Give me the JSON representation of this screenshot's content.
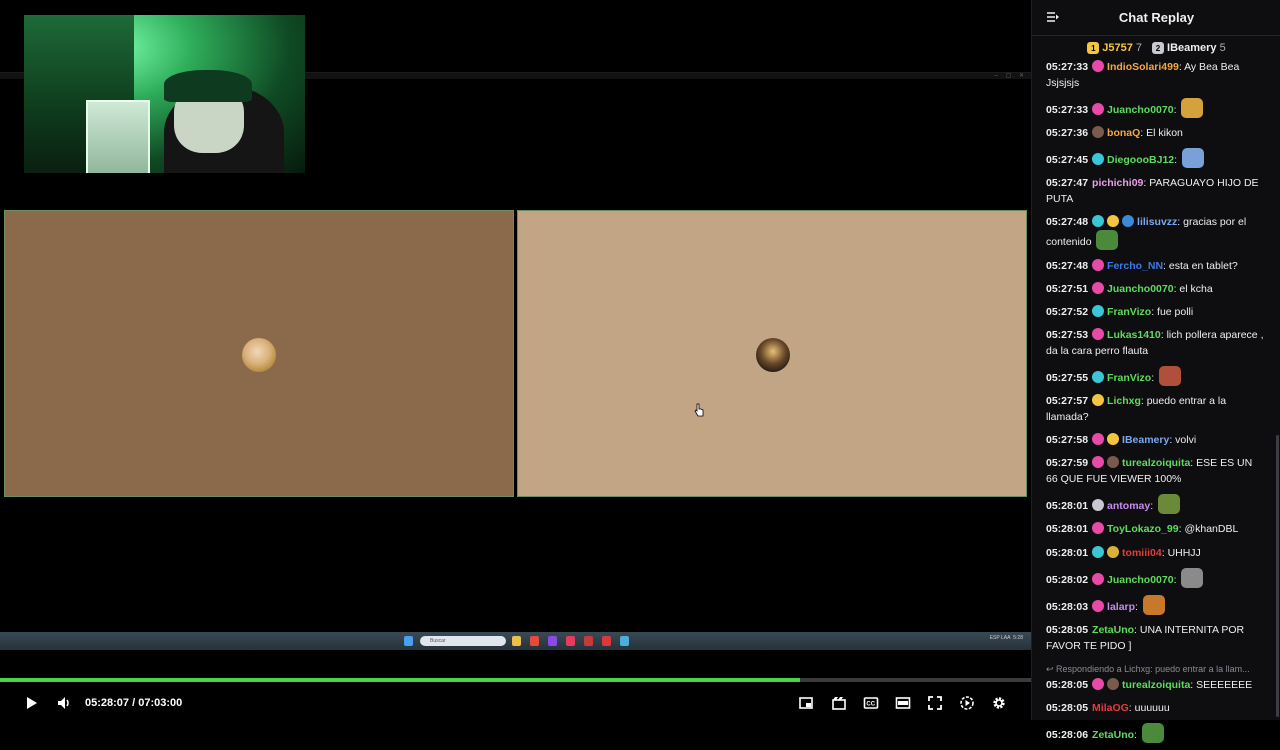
{
  "player": {
    "current_time": "05:28:07",
    "separator": "/",
    "duration": "07:03:00",
    "progress": 0.776
  },
  "desktop": {
    "search_placeholder": "Buscar",
    "tray_lang": "ESP LAA",
    "tray_time": "5:28"
  },
  "chat": {
    "title": "Chat Replay",
    "leaderboard": [
      {
        "rank": "1",
        "name": "J5757",
        "count": "7",
        "name_color": "#f5c542",
        "rank_bg": "#f5c542"
      },
      {
        "rank": "2",
        "name": "IBeamery",
        "count": "5",
        "name_color": "#efeff1",
        "rank_bg": "#c8c8d0"
      }
    ],
    "messages": [
      {
        "time": "05:27:33",
        "badges": [
          "#e84aa8"
        ],
        "user": "IndioSolari499",
        "color": "#f5a742",
        "text": "Ay Bea Bea Jsjsjsjs",
        "emote": ""
      },
      {
        "time": "05:27:33",
        "badges": [
          "#e84aa8"
        ],
        "user": "Juancho0070",
        "color": "#5cdc5c",
        "text": "",
        "emote": "#d4a23a"
      },
      {
        "time": "05:27:36",
        "badges": [
          "#7a5a4a"
        ],
        "user": "bonaQ",
        "color": "#f5a742",
        "text": "El kikon",
        "emote": ""
      },
      {
        "time": "05:27:45",
        "badges": [
          "#3ac6d6"
        ],
        "user": "DiegoooBJ12",
        "color": "#5cdc5c",
        "text": "",
        "emote": "#7aa0d8"
      },
      {
        "time": "05:27:47",
        "badges": [],
        "user": "pichichi09",
        "color": "#e8a0e8",
        "text": "PARAGUAYO HIJO DE PUTA",
        "emote": ""
      },
      {
        "time": "05:27:48",
        "badges": [
          "#3ac6d6",
          "#f5c542",
          "#3a8ad8"
        ],
        "user": "lilisuvzz",
        "color": "#7aa8f0",
        "text": "gracias por el contenido",
        "emote": "#4a8a3a"
      },
      {
        "time": "05:27:48",
        "badges": [
          "#e84aa8"
        ],
        "user": "Fercho_NN",
        "color": "#3a7ae8",
        "text": "esta en tablet?",
        "emote": ""
      },
      {
        "time": "05:27:51",
        "badges": [
          "#e84aa8"
        ],
        "user": "Juancho0070",
        "color": "#5cdc5c",
        "text": "el kcha",
        "emote": ""
      },
      {
        "time": "05:27:52",
        "badges": [
          "#3ac6d6"
        ],
        "user": "FranVizo",
        "color": "#5cdc5c",
        "text": "fue polli",
        "emote": ""
      },
      {
        "time": "05:27:53",
        "badges": [
          "#e84aa8"
        ],
        "user": "Lukas1410",
        "color": "#5cdc5c",
        "text": "lich pollera aparece , da la cara perro flauta",
        "emote": ""
      },
      {
        "time": "05:27:55",
        "badges": [
          "#3ac6d6"
        ],
        "user": "FranVizo",
        "color": "#5cdc5c",
        "text": "",
        "emote": "#b0503a"
      },
      {
        "time": "05:27:57",
        "badges": [
          "#f5c542"
        ],
        "user": "Lichxg",
        "color": "#5cdc5c",
        "text": "puedo entrar a la llamada?",
        "emote": ""
      },
      {
        "time": "05:27:58",
        "badges": [
          "#e84aa8",
          "#f5c542"
        ],
        "user": "IBeamery",
        "color": "#7aa8f0",
        "text": "volvi",
        "emote": ""
      },
      {
        "time": "05:27:59",
        "badges": [
          "#e84aa8",
          "#7a5a4a"
        ],
        "user": "turealzoiquita",
        "color": "#5cdc5c",
        "text": "ESE ES UN 66 QUE FUE VIEWER 100%",
        "emote": ""
      },
      {
        "time": "05:28:01",
        "badges": [
          "#c8c8d0"
        ],
        "user": "antomay",
        "color": "#c88af0",
        "text": "",
        "emote": "#6a8a3a"
      },
      {
        "time": "05:28:01",
        "badges": [
          "#e84aa8"
        ],
        "user": "ToyLokazo_99",
        "color": "#5cdc5c",
        "text": "@khanDBL",
        "emote": ""
      },
      {
        "time": "05:28:01",
        "badges": [
          "#3ac6d6",
          "#d8b03a"
        ],
        "user": "tomiii04",
        "color": "#e83a3a",
        "text": "UHHJJ",
        "emote": ""
      },
      {
        "time": "05:28:02",
        "badges": [
          "#e84aa8"
        ],
        "user": "Juancho0070",
        "color": "#5cdc5c",
        "text": "",
        "emote": "#8a8a8a"
      },
      {
        "time": "05:28:03",
        "badges": [
          "#e84aa8"
        ],
        "user": "lalarp",
        "color": "#c88af0",
        "text": "",
        "emote": "#c8782a"
      },
      {
        "time": "05:28:05",
        "badges": [],
        "user": "ZetaUno",
        "color": "#5cdc5c",
        "text": "UNA INTERNITA POR FAVOR TE PIDO ]",
        "emote": ""
      },
      {
        "reply": "Respondiendo a Lichxg: puedo entrar a la llam..."
      },
      {
        "time": "05:28:05",
        "badges": [
          "#e84aa8",
          "#7a5a4a"
        ],
        "user": "turealzoiquita",
        "color": "#5cdc5c",
        "text": "SEEEEEEE",
        "emote": ""
      },
      {
        "time": "05:28:05",
        "badges": [],
        "user": "MilaOG",
        "color": "#e83a3a",
        "text": "uuuuuu",
        "emote": ""
      },
      {
        "time": "05:28:06",
        "badges": [],
        "user": "ZetaUno",
        "color": "#5cdc5c",
        "text": "",
        "emote": "#4a8a3a"
      }
    ]
  }
}
